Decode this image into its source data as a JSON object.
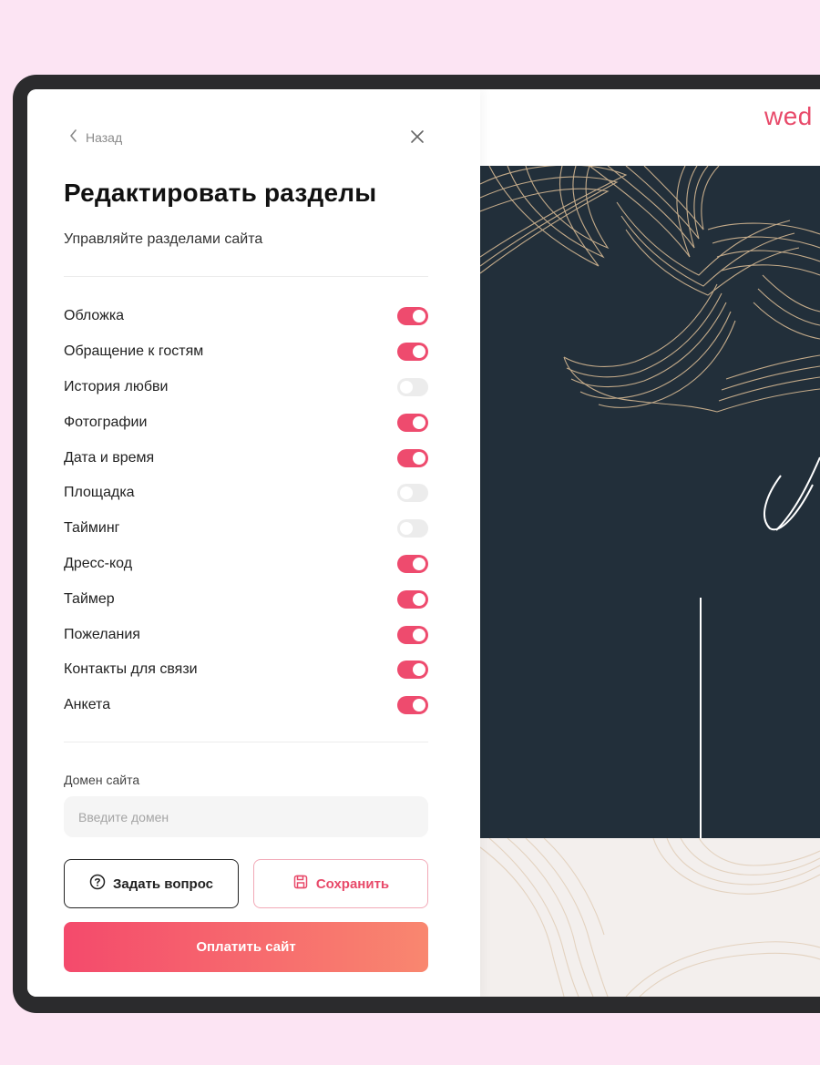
{
  "panel": {
    "back_label": "Назад",
    "title": "Редактировать разделы",
    "subtitle": "Управляйте разделами сайта",
    "sections": [
      {
        "label": "Обложка",
        "enabled": true
      },
      {
        "label": "Обращение к гостям",
        "enabled": true
      },
      {
        "label": "История любви",
        "enabled": false
      },
      {
        "label": "Фотографии",
        "enabled": true
      },
      {
        "label": "Дата и время",
        "enabled": true
      },
      {
        "label": "Площадка",
        "enabled": false
      },
      {
        "label": "Тайминг",
        "enabled": false
      },
      {
        "label": "Дресс-код",
        "enabled": true
      },
      {
        "label": "Таймер",
        "enabled": true
      },
      {
        "label": "Пожелания",
        "enabled": true
      },
      {
        "label": "Контакты для связи",
        "enabled": true
      },
      {
        "label": "Анкета",
        "enabled": true
      }
    ],
    "domain": {
      "label": "Домен сайта",
      "value": "",
      "placeholder": "Введите домен"
    },
    "buttons": {
      "ask": "Задать вопрос",
      "save": "Сохранить",
      "pay": "Оплатить сайт"
    }
  },
  "preview": {
    "logo_text": "wed"
  },
  "colors": {
    "accent": "#ee4b6e",
    "page_background": "#fce4f3",
    "hero_background": "#222f3a",
    "line_art": "#cdb28f"
  },
  "icons": {
    "back": "chevron-left-icon",
    "close": "close-icon",
    "ask": "question-circle-icon",
    "save": "floppy-disk-icon"
  }
}
